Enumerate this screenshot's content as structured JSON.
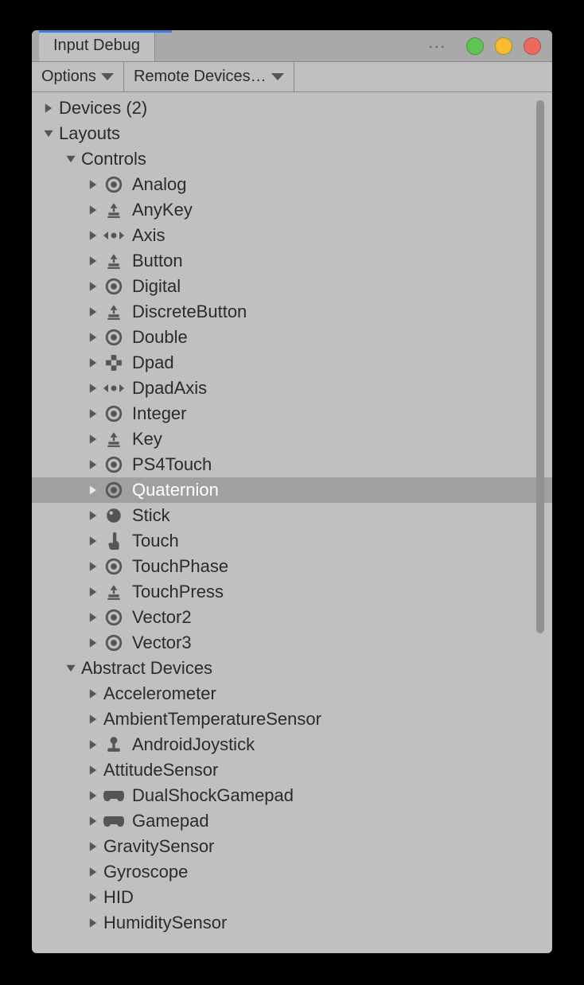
{
  "tab_title": "Input Debug",
  "toolbar": {
    "options": "Options",
    "remote": "Remote Devices…"
  },
  "tree": [
    {
      "depth": 0,
      "expand": "right",
      "icon": "",
      "label": "Devices (2)"
    },
    {
      "depth": 0,
      "expand": "down",
      "icon": "",
      "label": "Layouts"
    },
    {
      "depth": 1,
      "expand": "down",
      "icon": "",
      "label": "Controls"
    },
    {
      "depth": 2,
      "expand": "right",
      "icon": "target",
      "label": "Analog"
    },
    {
      "depth": 2,
      "expand": "right",
      "icon": "press",
      "label": "AnyKey"
    },
    {
      "depth": 2,
      "expand": "right",
      "icon": "axis",
      "label": "Axis"
    },
    {
      "depth": 2,
      "expand": "right",
      "icon": "press",
      "label": "Button"
    },
    {
      "depth": 2,
      "expand": "right",
      "icon": "target",
      "label": "Digital"
    },
    {
      "depth": 2,
      "expand": "right",
      "icon": "press",
      "label": "DiscreteButton"
    },
    {
      "depth": 2,
      "expand": "right",
      "icon": "target",
      "label": "Double"
    },
    {
      "depth": 2,
      "expand": "right",
      "icon": "dpad",
      "label": "Dpad"
    },
    {
      "depth": 2,
      "expand": "right",
      "icon": "axis",
      "label": "DpadAxis"
    },
    {
      "depth": 2,
      "expand": "right",
      "icon": "target",
      "label": "Integer"
    },
    {
      "depth": 2,
      "expand": "right",
      "icon": "press",
      "label": "Key"
    },
    {
      "depth": 2,
      "expand": "right",
      "icon": "target",
      "label": "PS4Touch"
    },
    {
      "depth": 2,
      "expand": "right",
      "icon": "target",
      "label": "Quaternion",
      "selected": true
    },
    {
      "depth": 2,
      "expand": "right",
      "icon": "circle",
      "label": "Stick"
    },
    {
      "depth": 2,
      "expand": "right",
      "icon": "touch",
      "label": "Touch"
    },
    {
      "depth": 2,
      "expand": "right",
      "icon": "target",
      "label": "TouchPhase"
    },
    {
      "depth": 2,
      "expand": "right",
      "icon": "press",
      "label": "TouchPress"
    },
    {
      "depth": 2,
      "expand": "right",
      "icon": "target",
      "label": "Vector2"
    },
    {
      "depth": 2,
      "expand": "right",
      "icon": "target",
      "label": "Vector3"
    },
    {
      "depth": 1,
      "expand": "down",
      "icon": "",
      "label": "Abstract Devices"
    },
    {
      "depth": 2,
      "expand": "right",
      "icon": "",
      "label": "Accelerometer"
    },
    {
      "depth": 2,
      "expand": "right",
      "icon": "",
      "label": "AmbientTemperatureSensor"
    },
    {
      "depth": 2,
      "expand": "right",
      "icon": "joy",
      "label": "AndroidJoystick"
    },
    {
      "depth": 2,
      "expand": "right",
      "icon": "",
      "label": "AttitudeSensor"
    },
    {
      "depth": 2,
      "expand": "right",
      "icon": "pad",
      "label": "DualShockGamepad"
    },
    {
      "depth": 2,
      "expand": "right",
      "icon": "pad",
      "label": "Gamepad"
    },
    {
      "depth": 2,
      "expand": "right",
      "icon": "",
      "label": "GravitySensor"
    },
    {
      "depth": 2,
      "expand": "right",
      "icon": "",
      "label": "Gyroscope"
    },
    {
      "depth": 2,
      "expand": "right",
      "icon": "",
      "label": "HID"
    },
    {
      "depth": 2,
      "expand": "right",
      "icon": "",
      "label": "HumiditySensor"
    }
  ]
}
